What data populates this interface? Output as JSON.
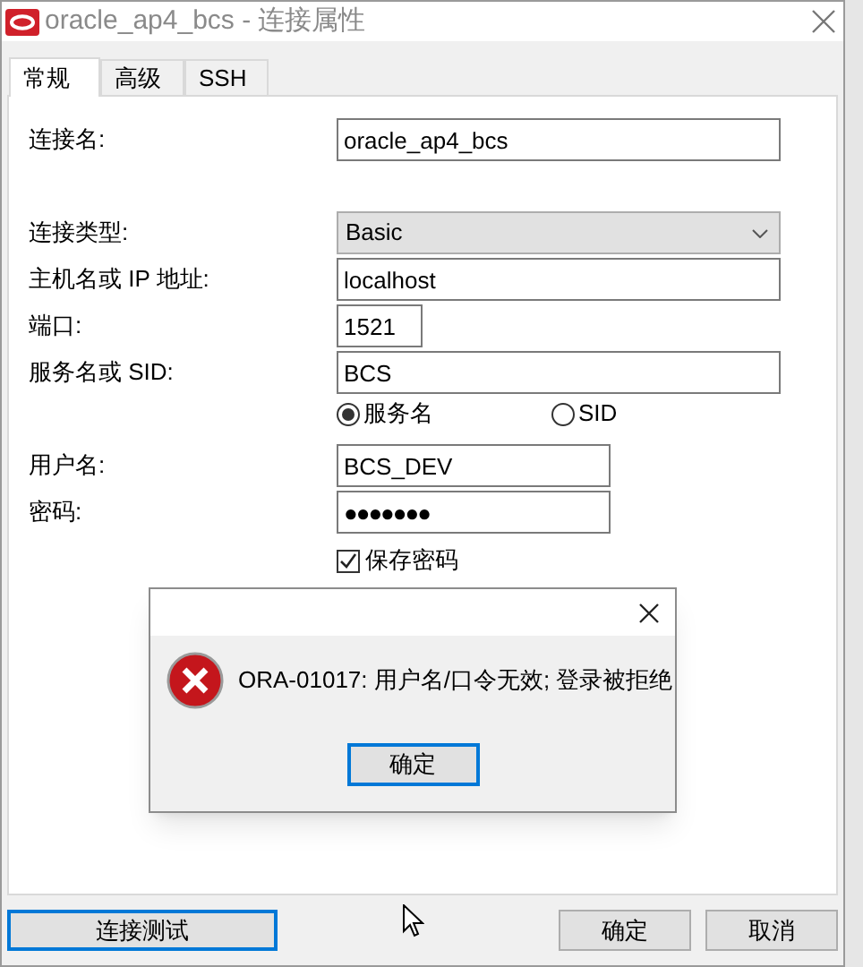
{
  "window": {
    "title": "oracle_ap4_bcs - 连接属性"
  },
  "tabs": [
    {
      "label": "常规",
      "selected": true
    },
    {
      "label": "高级",
      "selected": false
    },
    {
      "label": "SSH",
      "selected": false
    }
  ],
  "groups": [
    [
      {
        "kind": "text",
        "label": "连接名:",
        "value": "oracle_ap4_bcs"
      }
    ],
    [
      {
        "kind": "select",
        "label": "连接类型:",
        "value": "Basic"
      },
      {
        "kind": "text",
        "label": "主机名或 IP 地址:",
        "value": "localhost"
      },
      {
        "kind": "text",
        "label": "端口:",
        "value": "1521"
      },
      {
        "kind": "text",
        "label": "服务名或 SID:",
        "value": "BCS"
      },
      {
        "kind": "radios",
        "options": [
          {
            "label": "服务名",
            "selected": true
          },
          {
            "label": "SID",
            "selected": false
          }
        ]
      }
    ],
    [
      {
        "kind": "text",
        "label": "用户名:",
        "value": "BCS_DEV"
      },
      {
        "kind": "password",
        "label": "密码:",
        "value": "●●●●●●●"
      },
      {
        "kind": "checkbox",
        "label": "保存密码",
        "checked": true
      }
    ]
  ],
  "buttons": [
    {
      "label": "连接测试",
      "focused": true
    },
    {
      "label": "确定",
      "focused": false
    },
    {
      "label": "取消",
      "focused": false
    }
  ],
  "dialog": {
    "message": "ORA-01017: 用户名/口令无效; 登录被拒绝",
    "button": {
      "label": "确定",
      "focused": true
    }
  }
}
